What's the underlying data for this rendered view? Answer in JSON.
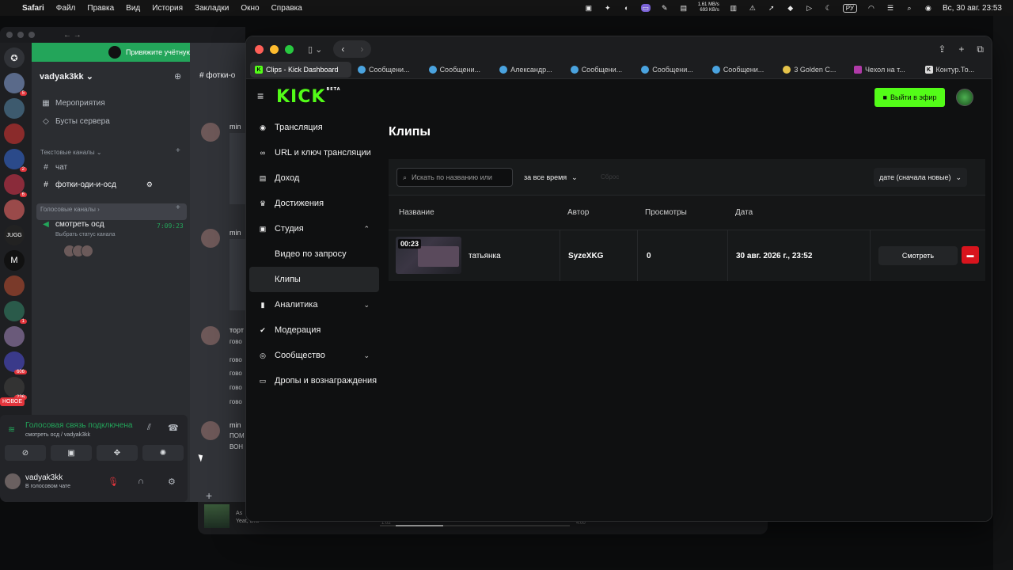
{
  "menubar": {
    "items": [
      "Safari",
      "Файл",
      "Правка",
      "Вид",
      "История",
      "Закладки",
      "Окно",
      "Справка"
    ],
    "net_up": "1.61 MB/s",
    "net_down": "693 KB/s",
    "lang": "РУ",
    "clock": "Вс, 30 авг. 23:53"
  },
  "discord": {
    "spotify_banner": "Привяжите учётную запись Spotify,",
    "server_name": "vadyak3kk",
    "top_items": [
      {
        "label": "Мероприятия",
        "icon": "calendar-icon"
      },
      {
        "label": "Бусты сервера",
        "icon": "boost-icon"
      }
    ],
    "text_category": "Текстовые каналы",
    "text_channels": [
      "чат",
      "фотки-оди-и-осд"
    ],
    "voice_category": "Голосовые каналы",
    "voice_channel": "смотреть осд",
    "voice_timer": "7:09:23",
    "voice_status_hint": "Выбрать статус канала",
    "server_badges": [
      "5",
      "2",
      "6",
      "1",
      "606",
      "236"
    ],
    "new_badge": "НОВОЕ",
    "server_labels": {
      "jugg": "JUGG",
      "m": "M"
    },
    "voice_connected": "Голосовая связь подключена",
    "voice_connected_sub": "смотреть осд / vadyak3kk",
    "user_name": "vadyak3kk",
    "user_status": "В голосовом чате",
    "chat_header": "фотки-о",
    "chat_users": [
      "min",
      "min",
      "торт",
      "min"
    ],
    "chat_lines": [
      "гово",
      "гово",
      "гово",
      "гово",
      "гово",
      "ПОМ",
      "ВОН"
    ]
  },
  "background_player": {
    "title": "As",
    "subtitle": "Yeat, Dra",
    "time_current": "1:02",
    "time_total": "4:00"
  },
  "safari": {
    "tabs": [
      {
        "label": "Clips - Kick Dashboard",
        "favicon": "K",
        "color": "#53fc18"
      },
      {
        "label": "Сообщени...",
        "favicon": "",
        "color": "#4aa3df"
      },
      {
        "label": "Сообщени...",
        "favicon": "",
        "color": "#4aa3df"
      },
      {
        "label": "Александр...",
        "favicon": "",
        "color": "#4aa3df"
      },
      {
        "label": "Сообщени...",
        "favicon": "",
        "color": "#4aa3df"
      },
      {
        "label": "Сообщени...",
        "favicon": "",
        "color": "#4aa3df"
      },
      {
        "label": "Сообщени...",
        "favicon": "",
        "color": "#4aa3df"
      },
      {
        "label": "3 Golden C...",
        "favicon": "",
        "color": "#e5c34a"
      },
      {
        "label": "Чехол на т...",
        "favicon": "",
        "color": "#b03aa8"
      },
      {
        "label": "Контур.То...",
        "favicon": "K",
        "color": "#dddddd"
      }
    ]
  },
  "kick": {
    "logo": "KICK",
    "logo_badge": "BETA",
    "go_live": "Выйти в эфир",
    "nav": [
      {
        "label": "Трансляция",
        "icon": "broadcast-icon",
        "chevron": "",
        "sub": false,
        "active": false
      },
      {
        "label": "URL и ключ трансляции",
        "icon": "link-icon",
        "chevron": "",
        "sub": false,
        "active": false
      },
      {
        "label": "Доход",
        "icon": "income-icon",
        "chevron": "",
        "sub": false,
        "active": false
      },
      {
        "label": "Достижения",
        "icon": "trophy-icon",
        "chevron": "",
        "sub": false,
        "active": false
      },
      {
        "label": "Студия",
        "icon": "studio-icon",
        "chevron": "⌃",
        "sub": false,
        "active": false
      },
      {
        "label": "Видео по запросу",
        "icon": "",
        "chevron": "",
        "sub": true,
        "active": false
      },
      {
        "label": "Клипы",
        "icon": "",
        "chevron": "",
        "sub": true,
        "active": true
      },
      {
        "label": "Аналитика",
        "icon": "analytics-icon",
        "chevron": "⌄",
        "sub": false,
        "active": false
      },
      {
        "label": "Модерация",
        "icon": "wrench-icon",
        "chevron": "",
        "sub": false,
        "active": false
      },
      {
        "label": "Сообщество",
        "icon": "community-icon",
        "chevron": "⌄",
        "sub": false,
        "active": false
      },
      {
        "label": "Дропы и вознаграждения",
        "icon": "gift-icon",
        "chevron": "",
        "sub": false,
        "active": false
      }
    ],
    "page_title": "Клипы",
    "search_placeholder": "Искать по названию или",
    "time_filter": "за все время",
    "reset": "Сброс",
    "sort": "дате (сначала новые)",
    "columns": [
      "Название",
      "Автор",
      "Просмотры",
      "Дата"
    ],
    "clips": [
      {
        "duration": "00:23",
        "title": "татьянка",
        "author": "SyzeXKG",
        "views": "0",
        "date": "30 авг. 2026 г., 23:52",
        "watch_label": "Смотреть"
      }
    ]
  },
  "colors": {
    "kick_green": "#53fc18",
    "delete_red": "#d8141d",
    "discord_green": "#23a55a"
  }
}
